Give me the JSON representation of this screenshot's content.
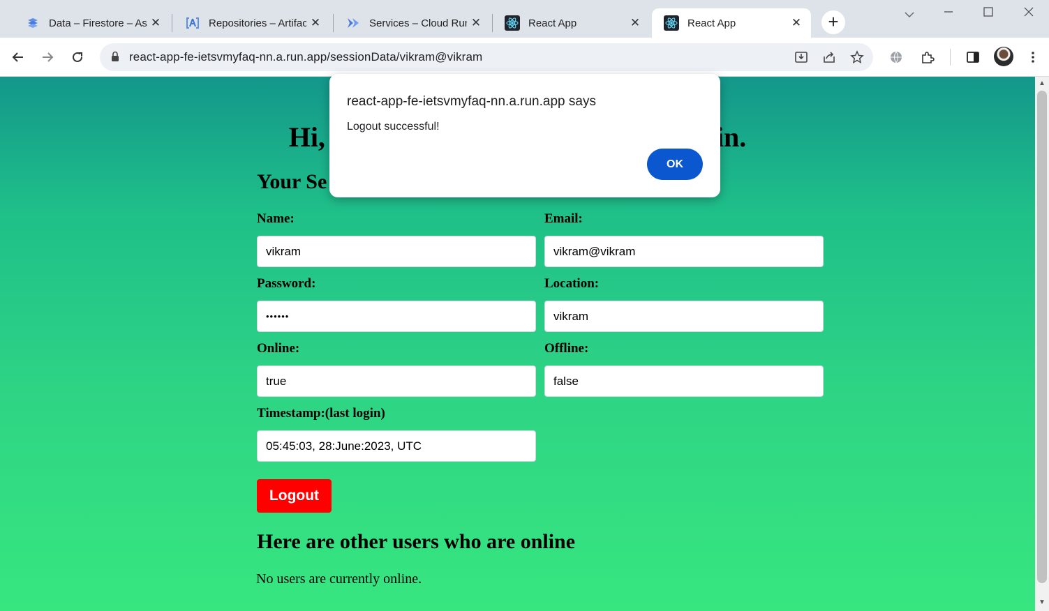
{
  "browser": {
    "tabs": [
      {
        "title": "Data – Firestore – As",
        "icon": "firestore-icon",
        "active": false
      },
      {
        "title": "Repositories – Artifac",
        "icon": "artifact-registry-icon",
        "active": false
      },
      {
        "title": "Services – Cloud Run",
        "icon": "cloud-run-icon",
        "active": false
      },
      {
        "title": "React App",
        "icon": "react-icon",
        "active": false
      },
      {
        "title": "React App",
        "icon": "react-icon",
        "active": true
      }
    ],
    "close_glyph": "✕",
    "new_tab_glyph": "+",
    "url": "react-app-fe-ietsvmyfaq-nn.a.run.app/sessionData/vikram@vikram"
  },
  "page": {
    "greeting_left": "Hi,",
    "greeting_right": "in.",
    "session_heading": "Your Se",
    "fields": {
      "name_label": "Name:",
      "name_value": "vikram",
      "email_label": "Email:",
      "email_value": "vikram@vikram",
      "password_label": "Password:",
      "password_value": "••••••",
      "location_label": "Location:",
      "location_value": "vikram",
      "online_label": "Online:",
      "online_value": "true",
      "offline_label": "Offline:",
      "offline_value": "false",
      "timestamp_label": "Timestamp:(last login)",
      "timestamp_value": "05:45:03, 28:June:2023, UTC"
    },
    "logout_label": "Logout",
    "online_heading": "Here are other users who are online",
    "online_empty": "No users are currently online."
  },
  "dialog": {
    "title": "react-app-fe-ietsvmyfaq-nn.a.run.app says",
    "message": "Logout successful!",
    "ok_label": "OK"
  },
  "colors": {
    "gradient_top": "#13978b",
    "gradient_bottom": "#37e67f",
    "logout_bg": "#ff0000",
    "dialog_ok_bg": "#0b57d0"
  }
}
